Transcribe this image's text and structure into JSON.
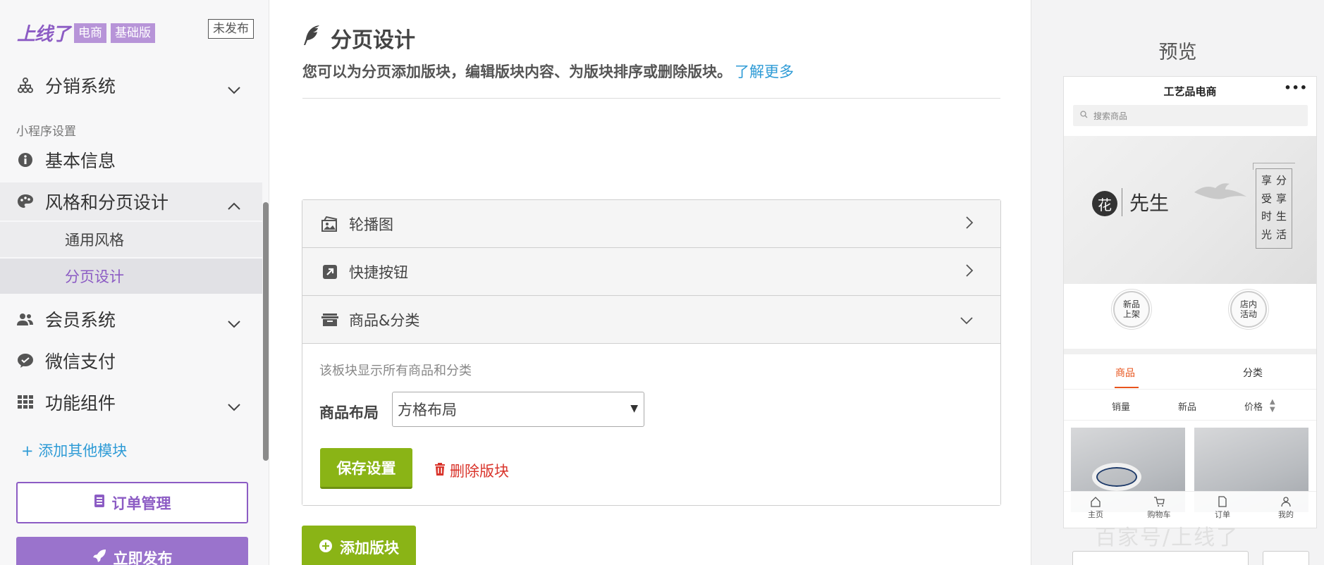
{
  "sidebar": {
    "brand": {
      "logo": "上线了",
      "tag1": "电商",
      "tag2": "基础版"
    },
    "status_badge": "未发布",
    "distribution": "分销系统",
    "section_label": "小程序设置",
    "basic_info": "基本信息",
    "style_design": "风格和分页设计",
    "general_style": "通用风格",
    "page_design": "分页设计",
    "member_system": "会员系统",
    "wechat_pay": "微信支付",
    "components": "功能组件",
    "add_module": "+ 添加其他模块",
    "orders_button": "订单管理",
    "publish_button": "立即发布"
  },
  "main": {
    "title": "分页设计",
    "subtitle": "您可以为分页添加版块，编辑版块内容、为版块排序或删除版块。",
    "learn_more": "了解更多",
    "blocks": [
      {
        "label": "轮播图",
        "icon": "image-icon"
      },
      {
        "label": "快捷按钮",
        "icon": "external-link-icon"
      },
      {
        "label": "商品&分类",
        "icon": "archive-icon"
      }
    ],
    "expanded": {
      "description": "该板块显示所有商品和分类",
      "layout_label": "商品布局",
      "layout_value": "方格布局",
      "save_button": "保存设置",
      "delete_button": "删除版块"
    },
    "add_block_button": "添加版块"
  },
  "preview": {
    "title": "预览",
    "shop_name": "工艺品电商",
    "menu_dots": "•••",
    "search_placeholder": "搜索商品",
    "banner": {
      "flower_char": "花",
      "brand_text": "先生",
      "poem_chars": [
        "享",
        "分",
        "受",
        "享",
        "时",
        "生",
        "光",
        "活"
      ]
    },
    "quick_buttons": [
      "新品\n上架",
      "店内\n活动"
    ],
    "tabs": [
      "商品",
      "分类"
    ],
    "sort_options": [
      "销量",
      "新品",
      "价格"
    ],
    "footer": [
      "主页",
      "购物车",
      "订单",
      "我的"
    ],
    "watermark": "百家号/上线了"
  },
  "colors": {
    "brand_purple": "#8c5cc4",
    "accent_green": "#8ab416",
    "link_blue": "#2e9bd6",
    "danger_red": "#d9342b",
    "preview_active": "#e8541c"
  }
}
